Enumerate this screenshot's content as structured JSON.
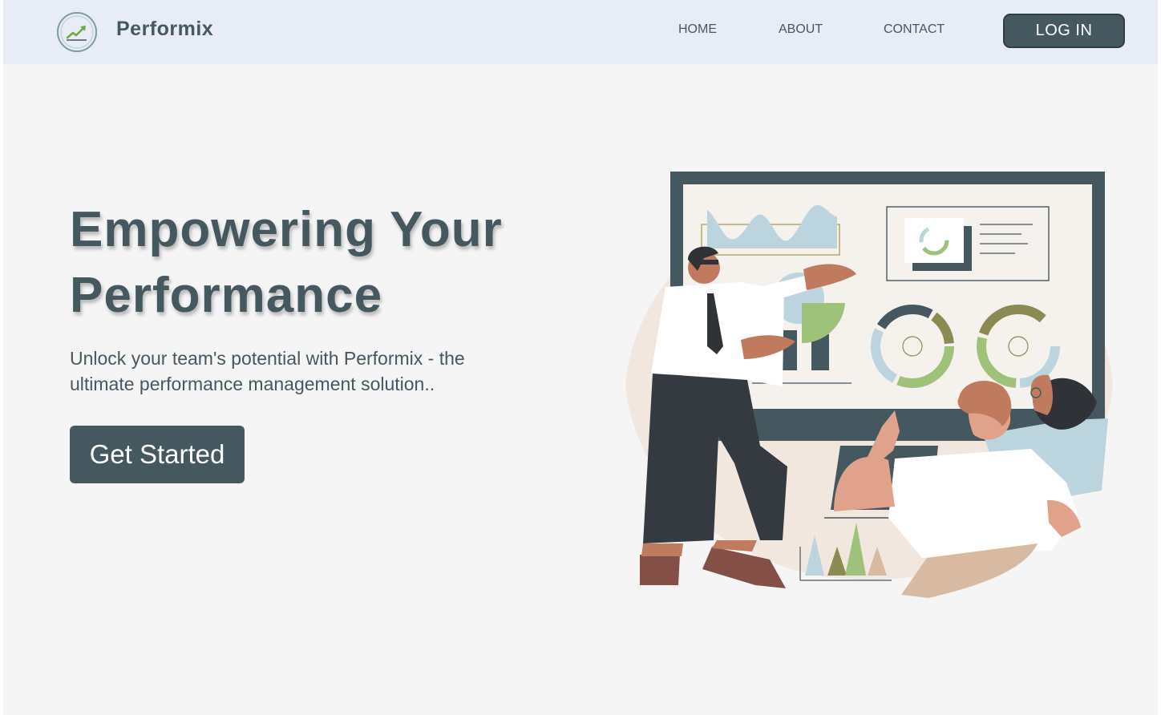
{
  "header": {
    "brand": "Performix",
    "nav": [
      "HOME",
      "ABOUT",
      "CONTACT"
    ],
    "login_label": "LOG IN"
  },
  "hero": {
    "title": "Empowering Your Performance",
    "subtitle": "Unlock your team's potential with Performix - the ultimate performance management solution..",
    "cta_label": "Get Started"
  },
  "icons": {
    "logo": "trend-up-chart-icon"
  },
  "colors": {
    "primary": "#45575f",
    "header_bg": "#e8ecf4",
    "page_bg": "#f5f5f5",
    "accent_green": "#9ec27a",
    "accent_blue": "#bcd4de",
    "accent_olive": "#8b8a52"
  }
}
